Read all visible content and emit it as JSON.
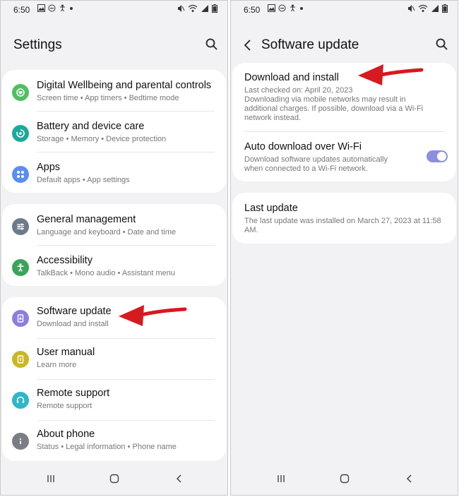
{
  "status_bar": {
    "time": "6:50"
  },
  "left": {
    "title": "Settings",
    "groups": [
      [
        {
          "title": "Digital Wellbeing and parental controls",
          "subtitle": "Screen time  •  App timers  •  Bedtime mode",
          "icon": "heart-leaf-icon",
          "color": "#4fbf60"
        },
        {
          "title": "Battery and device care",
          "subtitle": "Storage  •  Memory  •  Device protection",
          "icon": "device-care-icon",
          "color": "#1ba99a"
        },
        {
          "title": "Apps",
          "subtitle": "Default apps  •  App settings",
          "icon": "apps-grid-icon",
          "color": "#5b8ef0"
        }
      ],
      [
        {
          "title": "General management",
          "subtitle": "Language and keyboard  •  Date and time",
          "icon": "sliders-icon",
          "color": "#6c7a8a"
        },
        {
          "title": "Accessibility",
          "subtitle": "TalkBack  •  Mono audio  •  Assistant menu",
          "icon": "accessibility-icon",
          "color": "#3aa45a"
        }
      ],
      [
        {
          "title": "Software update",
          "subtitle": "Download and install",
          "icon": "software-update-icon",
          "color": "#8b7fe0"
        },
        {
          "title": "User manual",
          "subtitle": "Learn more",
          "icon": "user-manual-icon",
          "color": "#c9b724"
        },
        {
          "title": "Remote support",
          "subtitle": "Remote support",
          "icon": "headset-icon",
          "color": "#2db7c9"
        },
        {
          "title": "About phone",
          "subtitle": "Status  •  Legal information  •  Phone name",
          "icon": "info-icon",
          "color": "#7b7d85"
        }
      ]
    ]
  },
  "right": {
    "title": "Software update",
    "download": {
      "title": "Download and install",
      "last_checked": "Last checked on: April 20, 2023",
      "note_lines": [
        "Downloading via mobile networks may result in",
        "additional charges. If possible, download via a Wi-Fi",
        "network instead."
      ]
    },
    "auto": {
      "title": "Auto download over Wi-Fi",
      "desc_lines": [
        "Download software updates automatically",
        "when connected to a Wi-Fi network."
      ],
      "enabled": true
    },
    "last_update": {
      "title": "Last update",
      "desc_lines": [
        "The last update was installed on March 27, 2023 at 11:58",
        "AM."
      ]
    }
  },
  "colors": {
    "accent_arrow": "#d71920",
    "toggle_on": "#8c8fe0"
  }
}
